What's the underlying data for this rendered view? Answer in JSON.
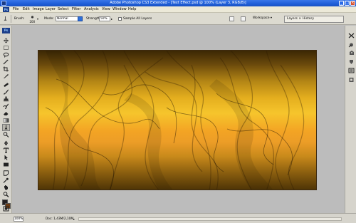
{
  "window": {
    "title": "Adobe Photoshop CS3 Extended - [Text Effect.psd @ 100% (Layer 3, RGB/8)]",
    "minimize": "_",
    "maximize": "□",
    "close": "×"
  },
  "app_badge": "Ps",
  "menu": {
    "items": [
      "File",
      "Edit",
      "Image",
      "Layer",
      "Select",
      "Filter",
      "Analysis",
      "View",
      "Window",
      "Help"
    ]
  },
  "options": {
    "brush_label": "Brush:",
    "brush_size": "200",
    "mode_label": "Mode:",
    "mode_value": "Normal",
    "strength_label": "Strength:",
    "strength_value": "50%",
    "sample_all_layers": "Sample All Layers",
    "workspace": "Workspace ▾"
  },
  "panels": {
    "tabs": [
      "Layers ×",
      "History"
    ]
  },
  "status": {
    "zoom": "100%",
    "doc": "Doc: 1,43M/2,10M",
    "arrow": "▸"
  },
  "colors": {
    "foreground": "#231f20",
    "background": "#6a3a12",
    "title_bar": "#1f5ed8"
  },
  "toolbox_icons": [
    "move-icon",
    "marquee-icon",
    "lasso-icon",
    "magic-wand-icon",
    "crop-icon",
    "slice-icon",
    "healing-brush-icon",
    "brush-icon",
    "clone-stamp-icon",
    "history-brush-icon",
    "eraser-icon",
    "gradient-icon",
    "smudge-icon",
    "dodge-icon",
    "pen-icon",
    "type-icon",
    "path-selection-icon",
    "rectangle-shape-icon",
    "notes-icon",
    "eyedropper-icon",
    "hand-icon",
    "zoom-icon"
  ],
  "dock_icons": [
    "navigator-icon",
    "color-icon",
    "swatches-icon",
    "styles-icon",
    "history-icon",
    "actions-icon"
  ]
}
